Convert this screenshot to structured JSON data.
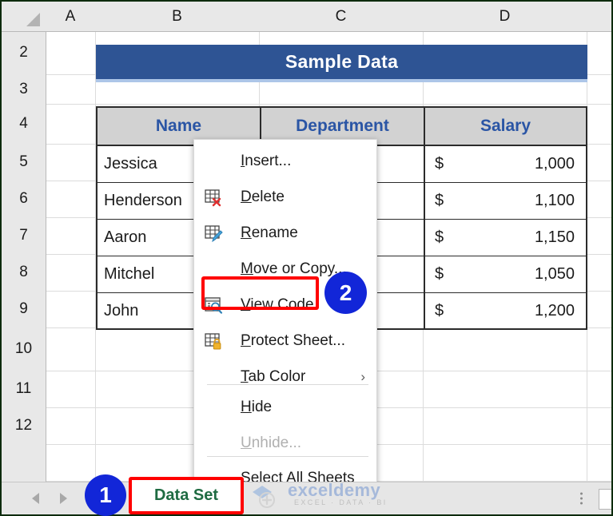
{
  "spreadsheet": {
    "column_headers": [
      "A",
      "B",
      "C",
      "D"
    ],
    "row_headers": [
      "2",
      "3",
      "4",
      "5",
      "6",
      "7",
      "8",
      "9",
      "10",
      "11",
      "12"
    ],
    "banner_title": "Sample Data",
    "banner_color": "#2e5494",
    "header_text_color": "#2a55a5",
    "table": {
      "columns": [
        "Name",
        "Department",
        "Salary"
      ],
      "rows": [
        {
          "name": "Jessica",
          "department": "",
          "currency": "$",
          "salary": "1,000"
        },
        {
          "name": "Henderson",
          "department": "",
          "currency": "$",
          "salary": "1,100"
        },
        {
          "name": "Aaron",
          "department": "",
          "currency": "$",
          "salary": "1,150"
        },
        {
          "name": "Mitchel",
          "department": "",
          "currency": "$",
          "salary": "1,050"
        },
        {
          "name": "John",
          "department": "",
          "currency": "$",
          "salary": "1,200"
        }
      ]
    }
  },
  "context_menu": {
    "items": [
      {
        "label": "Insert...",
        "icon": "none",
        "disabled": false,
        "submenu": false
      },
      {
        "label": "Delete",
        "icon": "delete-sheet-icon",
        "disabled": false,
        "submenu": false
      },
      {
        "label": "Rename",
        "icon": "rename-sheet-icon",
        "disabled": false,
        "submenu": false
      },
      {
        "label": "Move or Copy...",
        "icon": "none",
        "disabled": false,
        "submenu": false
      },
      {
        "label": "View Code",
        "icon": "view-code-icon",
        "disabled": false,
        "submenu": false
      },
      {
        "label": "Protect Sheet...",
        "icon": "protect-sheet-icon",
        "disabled": false,
        "submenu": false
      },
      {
        "label": "Tab Color",
        "icon": "none",
        "disabled": false,
        "submenu": true
      },
      {
        "label": "Hide",
        "icon": "none",
        "disabled": false,
        "submenu": false
      },
      {
        "label": "Unhide...",
        "icon": "none",
        "disabled": true,
        "submenu": false
      },
      {
        "label": "Select All Sheets",
        "icon": "none",
        "disabled": false,
        "submenu": false
      }
    ],
    "submenu_arrow": "›"
  },
  "callouts": {
    "badge_one": "1",
    "badge_two": "2",
    "highlight_color": "#ff0000",
    "badge_color": "#1226d8"
  },
  "bottom_bar": {
    "sheet_tab": "Data Set",
    "sheet_tab_color": "#1f6b42"
  },
  "watermark": {
    "brand": "exceldemy",
    "tagline": "EXCEL · DATA · BI"
  }
}
